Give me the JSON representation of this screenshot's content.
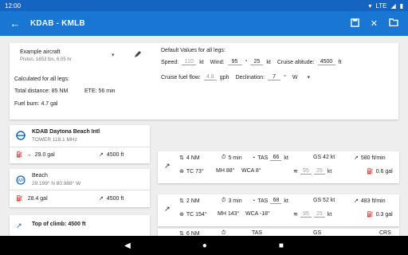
{
  "status": {
    "time": "12:00",
    "network": "LTE"
  },
  "appbar": {
    "title": "KDAB - KMLB"
  },
  "aircraft": {
    "name": "Example aircraft",
    "details": "Piston, 1653 lbs, 6:05 hr"
  },
  "calculated": {
    "heading": "Calculated for all legs:",
    "total_distance": "Total distance: 85 NM",
    "ete": "ETE: 56 min",
    "fuel_burn": "Fuel burn: 4.7 gal"
  },
  "defaults": {
    "heading": "Default Values for all legs:",
    "speed_label": "Speed:",
    "speed_value": "110",
    "speed_unit": "kt",
    "wind_label": "Wind:",
    "wind_dir": "95",
    "wind_dir_unit": "°",
    "wind_speed": "25",
    "wind_speed_unit": "kt",
    "alt_label": "Cruise altitude:",
    "alt_value": "4500",
    "alt_unit": "ft",
    "fuel_label": "Cruise fuel flow:",
    "fuel_value": "4.8",
    "fuel_unit": "gph",
    "decl_label": "Declination:",
    "decl_value": "7",
    "decl_unit": "°",
    "decl_dir": "W"
  },
  "waypoints": [
    {
      "name": "KDAB  Daytona Beach Intl",
      "sub": "TOWER 118.1 MHz",
      "fuel": "29.0 gal",
      "alt": "4500 ft"
    },
    {
      "name": "Beach",
      "sub": "29.199° N 80.988° W",
      "fuel": "28.4 gal",
      "alt": "4500 ft"
    },
    {
      "name": "Top of climb: 4500 ft"
    }
  ],
  "legs": [
    {
      "dist": "4 NM",
      "time": "5 min",
      "tas_label": "TAS",
      "tas": "66",
      "tas_unit": "kt",
      "gs": "GS 42 kt",
      "rate": "580 ft/min",
      "tc": "TC 73°",
      "mh": "MH 88°",
      "wca": "WCA 8°",
      "wind_dir": "95",
      "wind_speed": "25",
      "wind_unit": "kt",
      "fuel": "0.6 gal"
    },
    {
      "dist": "2 NM",
      "time": "3 min",
      "tas_label": "TAS",
      "tas": "68",
      "tas_unit": "kt",
      "gs": "GS 52 kt",
      "rate": "483 ft/min",
      "tc": "TC 154°",
      "mh": "MH 143°",
      "wca": "WCA -18°",
      "wind_dir": "95",
      "wind_speed": "25",
      "wind_unit": "kt",
      "fuel": "0.3 gal"
    },
    {
      "dist": "6 NM",
      "time": "",
      "tas_label": "TAS",
      "tas": "",
      "gs": "GS",
      "rate": "CRS"
    }
  ],
  "colors": {
    "primary": "#1976d2",
    "status": "#1565c0"
  }
}
